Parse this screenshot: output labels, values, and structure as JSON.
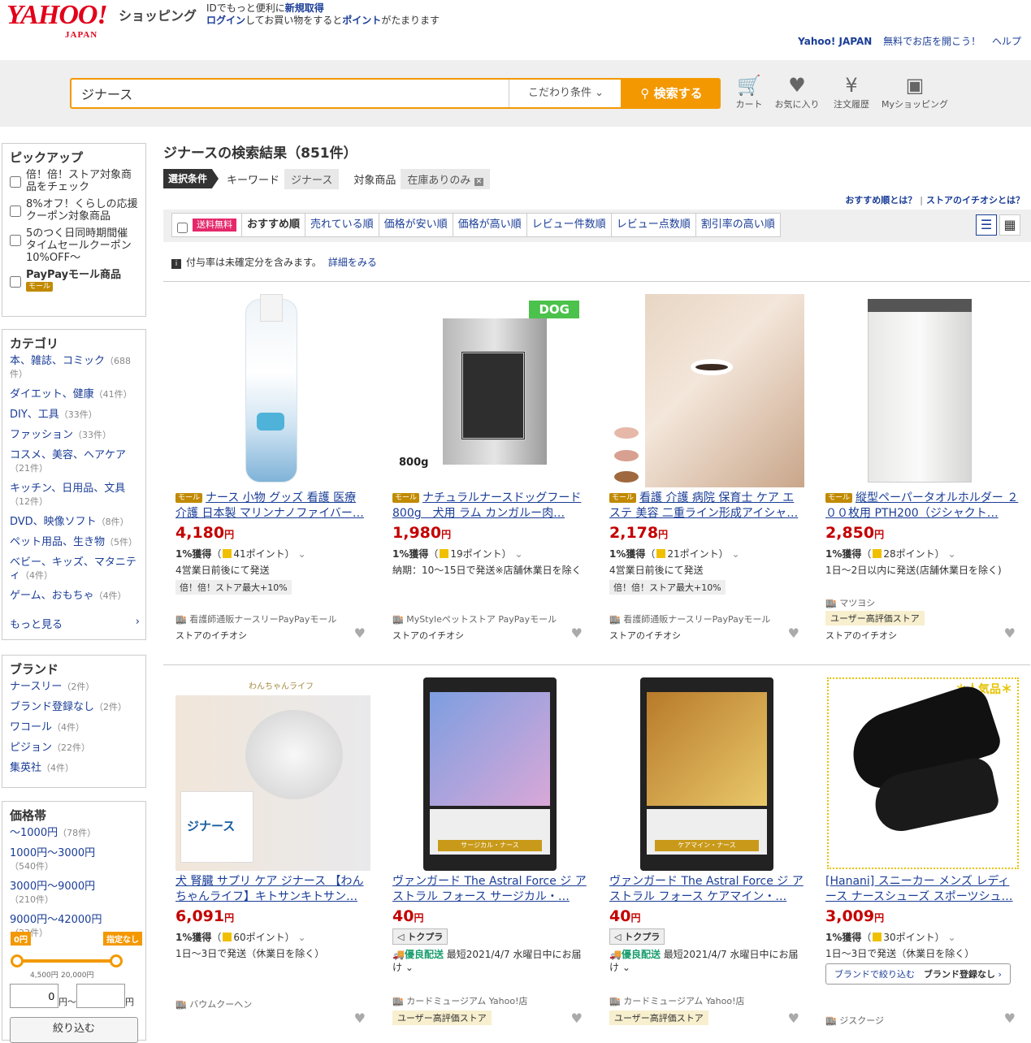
{
  "header": {
    "logo_main": "YAHOO!",
    "logo_sub": "JAPAN",
    "shopping": "ショッピング",
    "promo_line1_pre": "IDでもっと便利に",
    "promo_line1_link": "新規取得",
    "promo_line2_link1": "ログイン",
    "promo_line2_mid": "してお買い物をすると",
    "promo_line2_link2": "ポイント",
    "promo_line2_post": "がたまります",
    "links": [
      "Yahoo! JAPAN",
      "無料でお店を開こう！",
      "ヘルプ"
    ]
  },
  "search": {
    "query": "ジナース",
    "condition": "こだわり条件",
    "button": "検索する",
    "icons": [
      {
        "label": "カート",
        "icon": "cart-icon"
      },
      {
        "label": "お気に入り",
        "icon": "heart-icon"
      },
      {
        "label": "注文履歴",
        "icon": "history-icon"
      },
      {
        "label": "Myショッピング",
        "icon": "user-icon"
      }
    ]
  },
  "pickup": {
    "title": "ピックアップ",
    "items": [
      "倍！倍！ストア対象商品をチェック",
      "8%オフ！くらしの応援クーポン対象商品",
      "5のつく日同時期間催タイムセールクーポン10%OFF～",
      "PayPayモール商品"
    ],
    "paypay_badge": "モール"
  },
  "category": {
    "title": "カテゴリ",
    "items": [
      {
        "name": "本、雑誌、コミック",
        "count": "（688件）"
      },
      {
        "name": "ダイエット、健康",
        "count": "（41件）"
      },
      {
        "name": "DIY、工具",
        "count": "（33件）"
      },
      {
        "name": "ファッション",
        "count": "（33件）"
      },
      {
        "name": "コスメ、美容、ヘアケア",
        "count": "（21件）"
      },
      {
        "name": "キッチン、日用品、文具",
        "count": "（12件）"
      },
      {
        "name": "DVD、映像ソフト",
        "count": "（8件）"
      },
      {
        "name": "ペット用品、生き物",
        "count": "（5件）"
      },
      {
        "name": "ベビー、キッズ、マタニティ",
        "count": "（4件）"
      },
      {
        "name": "ゲーム、おもちゃ",
        "count": "（4件）"
      }
    ],
    "more": "もっと見る"
  },
  "brand": {
    "title": "ブランド",
    "items": [
      {
        "name": "ナースリー",
        "count": "（2件）"
      },
      {
        "name": "ブランド登録なし",
        "count": "（2件）"
      },
      {
        "name": "ワコール",
        "count": "（4件）"
      },
      {
        "name": "ピジョン",
        "count": "（22件）"
      },
      {
        "name": "集英社",
        "count": "（4件）"
      }
    ]
  },
  "pricefilter": {
    "title": "価格帯",
    "items": [
      {
        "name": "～1000円",
        "count": "（78件）"
      },
      {
        "name": "1000円～3000円",
        "count": "（540件）"
      },
      {
        "name": "3000円～9000円",
        "count": "（210件）"
      },
      {
        "name": "9000円～42000円",
        "count": "（23件）"
      }
    ],
    "min_badge": "0円",
    "max_badge": "指定なし",
    "tick1": "4,500円",
    "tick2": "20,000円",
    "min_value": "0",
    "yen1": "円～",
    "yen2": "円",
    "submit": "絞り込む"
  },
  "results": {
    "title": "ジナースの検索結果（851件）",
    "cond_tag": "選択条件",
    "keyword_label": "キーワード",
    "keyword": "ジナース",
    "target_label": "対象商品",
    "target": "在庫ありのみ",
    "help1": "おすすめ順とは？",
    "help2": "ストアのイチオシとは？",
    "free_ship": "送料無料",
    "sorts": [
      "おすすめ順",
      "売れている順",
      "価格が安い順",
      "価格が高い順",
      "レビュー件数順",
      "レビュー点数順",
      "割引率の高い順"
    ],
    "note": "付与率は未確定分を含みます。",
    "note_link": "詳細をみる"
  },
  "products": [
    {
      "name": "ナース 小物 グッズ 看護 医療 介護 日本製 マリンナノファイバー…",
      "mall": true,
      "price": "4,180",
      "pts_pre": "1%獲得",
      "pts": "41ポイント",
      "ship": "4営業日前後にて発送",
      "camp": "倍！倍！ストア最大+10%",
      "store": "看護師通販ナースリーPayPayモール",
      "ichi": "ストアのイチオシ"
    },
    {
      "name": "ナチュラルナースドッグフード 800g　犬用 ラム カンガルー肉…",
      "mall": true,
      "price": "1,980",
      "pts_pre": "1%獲得",
      "pts": "19ポイント",
      "ship": "納期：10～15日で発送※店舗休業日を除く",
      "store": "MyStyleペットストア PayPayモール",
      "ichi": "ストアのイチオシ"
    },
    {
      "name": "看護 介護 病院 保育士 ケア エステ 美容 二重ライン形成アイシャ…",
      "mall": true,
      "price": "2,178",
      "pts_pre": "1%獲得",
      "pts": "21ポイント",
      "ship": "4営業日前後にて発送",
      "camp": "倍！倍！ストア最大+10%",
      "store": "看護師通販ナースリーPayPayモール",
      "ichi": "ストアのイチオシ"
    },
    {
      "name": "縦型ペーパータオルホルダー ２００枚用 PTH200（ジシャクト…",
      "mall": true,
      "price": "2,850",
      "pts_pre": "1%獲得",
      "pts": "28ポイント",
      "ship": "1日～2日以内に発送(店舗休業日を除く)",
      "store": "マツヨシ",
      "rev": "ユーザー高評価ストア",
      "ichi": "ストアのイチオシ"
    },
    {
      "name": "犬 腎臓 サプリ ケア ジナース 【わんちゃんライフ】キトサンキトサン…",
      "price": "6,091",
      "pts_pre": "1%獲得",
      "pts": "60ポイント",
      "ship": "1日～3日で発送（休業日を除く）",
      "store": "バウムクーヘン"
    },
    {
      "name": "ヴァンガード The Astral Force ジ アストラル フォース サージカル・…",
      "price": "40",
      "tokupura": "トクプラ",
      "yuryo": "優良配送",
      "ship": "最短2021/4/7 水曜日中にお届け",
      "store": "カードミュージアム Yahoo!店",
      "rev": "ユーザー高評価ストア"
    },
    {
      "name": "ヴァンガード The Astral Force ジ アストラル フォース ケアマイン・…",
      "price": "40",
      "tokupura": "トクプラ",
      "yuryo": "優良配送",
      "ship": "最短2021/4/7 水曜日中にお届け",
      "store": "カードミュージアム Yahoo!店",
      "rev": "ユーザー高評価ストア"
    },
    {
      "name": "[Hanani] スニーカー メンズ レディース ナースシューズ スポーツシュ…",
      "price": "3,009",
      "pts_pre": "1%獲得",
      "pts": "30ポイント",
      "ship": "1日～3日で発送（休業日を除く）",
      "brand_pre": "ブランドで絞り込む",
      "brand": "ブランド登録なし",
      "store": "ジスクージ"
    }
  ],
  "img_text": {
    "dog": "DOG",
    "weight": "800g",
    "wanchan": "わんちゃんライフ",
    "jinasu": "ジナース",
    "popular": "＊人気品＊",
    "card1": "サージカル・ナース",
    "card2": "ケアマイン・ナース",
    "mall_badge": "モール",
    "yen": "円"
  },
  "colors": {
    "accent": "#f39800",
    "link": "#1a3d97",
    "price": "#c40000"
  }
}
